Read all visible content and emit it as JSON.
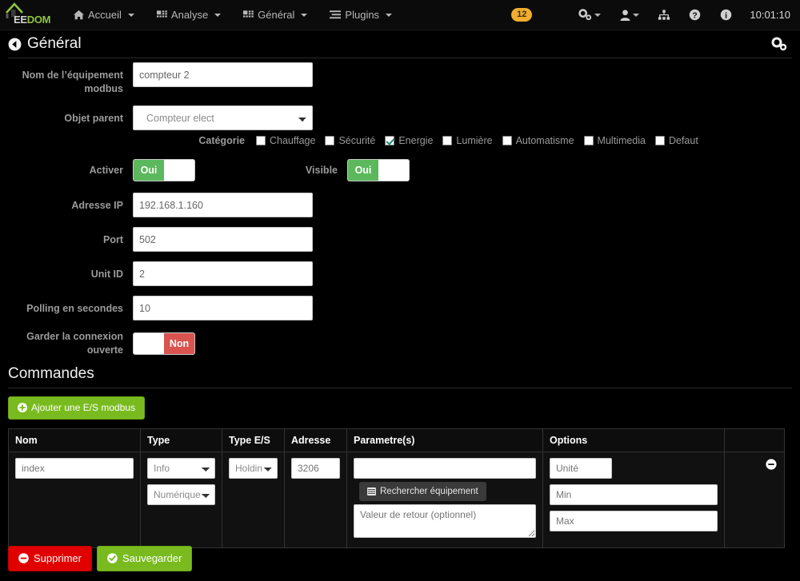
{
  "navbar": {
    "brand": {
      "ee": "EE",
      "dom": "DOM"
    },
    "items": [
      {
        "label": "Accueil",
        "icon": "home-icon",
        "caret": true
      },
      {
        "label": "Analyse",
        "icon": "grid-icon",
        "caret": true
      },
      {
        "label": "Général",
        "icon": "grid-icon",
        "caret": true
      },
      {
        "label": "Plugins",
        "icon": "bars-icon",
        "caret": true
      }
    ],
    "badge": "12",
    "right_icons": [
      {
        "name": "cogs-icon",
        "caret": true
      },
      {
        "name": "user-icon",
        "caret": true
      },
      {
        "name": "sitemap-icon",
        "caret": false
      },
      {
        "name": "help-icon",
        "caret": false
      },
      {
        "name": "info-icon",
        "caret": false
      }
    ],
    "clock": "10:01:10"
  },
  "header": {
    "back_icon": "arrow-circle-left-icon",
    "title": "Général",
    "gear_icon": "cogs-icon"
  },
  "form": {
    "name": {
      "label": "Nom de l’équipement modbus",
      "value": "compteur 2",
      "placeholder": ""
    },
    "parent": {
      "label": "Objet parent",
      "value": "Compteur elect",
      "options": [
        "Compteur elect"
      ]
    },
    "category": {
      "label": "Catégorie",
      "items": [
        {
          "label": "Chauffage",
          "checked": false
        },
        {
          "label": "Sécurité",
          "checked": false
        },
        {
          "label": "Energie",
          "checked": true
        },
        {
          "label": "Lumière",
          "checked": false
        },
        {
          "label": "Automatisme",
          "checked": false
        },
        {
          "label": "Multimedia",
          "checked": false
        },
        {
          "label": "Defaut",
          "checked": false
        }
      ]
    },
    "activer": {
      "label": "Activer",
      "state": "yes",
      "on_text": "Oui",
      "off_text": ""
    },
    "visible": {
      "label": "Visible",
      "state": "yes",
      "on_text": "Oui",
      "off_text": ""
    },
    "ip": {
      "label": "Adresse IP",
      "value": "192.168.1.160"
    },
    "port": {
      "label": "Port",
      "value": "502"
    },
    "unit_id": {
      "label": "Unit ID",
      "value": "2"
    },
    "polling": {
      "label": "Polling en secondes",
      "value": "10"
    },
    "keep_open": {
      "label": "Garder la connexion ouverte",
      "state": "no",
      "on_text": "",
      "off_text": "Non"
    }
  },
  "commands": {
    "title": "Commandes",
    "add_button": "Ajouter une E/S modbus",
    "add_icon": "plus-circle-icon",
    "columns": [
      "Nom",
      "Type",
      "Type E/S",
      "Adresse",
      "Parametre(s)",
      "Options",
      ""
    ],
    "rows": [
      {
        "nom": {
          "value": "",
          "placeholder": "index"
        },
        "type": {
          "value": "Info",
          "options": [
            "Info"
          ]
        },
        "type_sub": {
          "value": "Numérique",
          "options": [
            "Numérique"
          ]
        },
        "type_es": {
          "value": "Holding",
          "options": [
            "Holding"
          ]
        },
        "adresse": {
          "value": "",
          "placeholder": "3206"
        },
        "parametre": {
          "value": "",
          "placeholder": ""
        },
        "search_button": "Rechercher équipement",
        "search_icon": "table-icon",
        "retour": {
          "value": "",
          "placeholder": "Valeur de retour (optionnel)"
        },
        "unite": {
          "value": "",
          "placeholder": "Unité"
        },
        "min": {
          "value": "",
          "placeholder": "Min"
        },
        "max": {
          "value": "",
          "placeholder": "Max"
        },
        "remove_icon": "minus-circle-icon"
      }
    ]
  },
  "footer": {
    "delete": {
      "label": "Supprimer",
      "icon": "minus-circle-icon"
    },
    "save": {
      "label": "Sauvegarder",
      "icon": "check-circle-icon"
    }
  },
  "colors": {
    "brand_green": "#8dc63f",
    "accent_green": "#79bb1f",
    "toggle_on": "#5cb85c",
    "toggle_off": "#d9534f",
    "badge": "#f0ad2e",
    "delete_red": "#e00000",
    "check_teal": "#1f8a70",
    "background": "#000000"
  }
}
